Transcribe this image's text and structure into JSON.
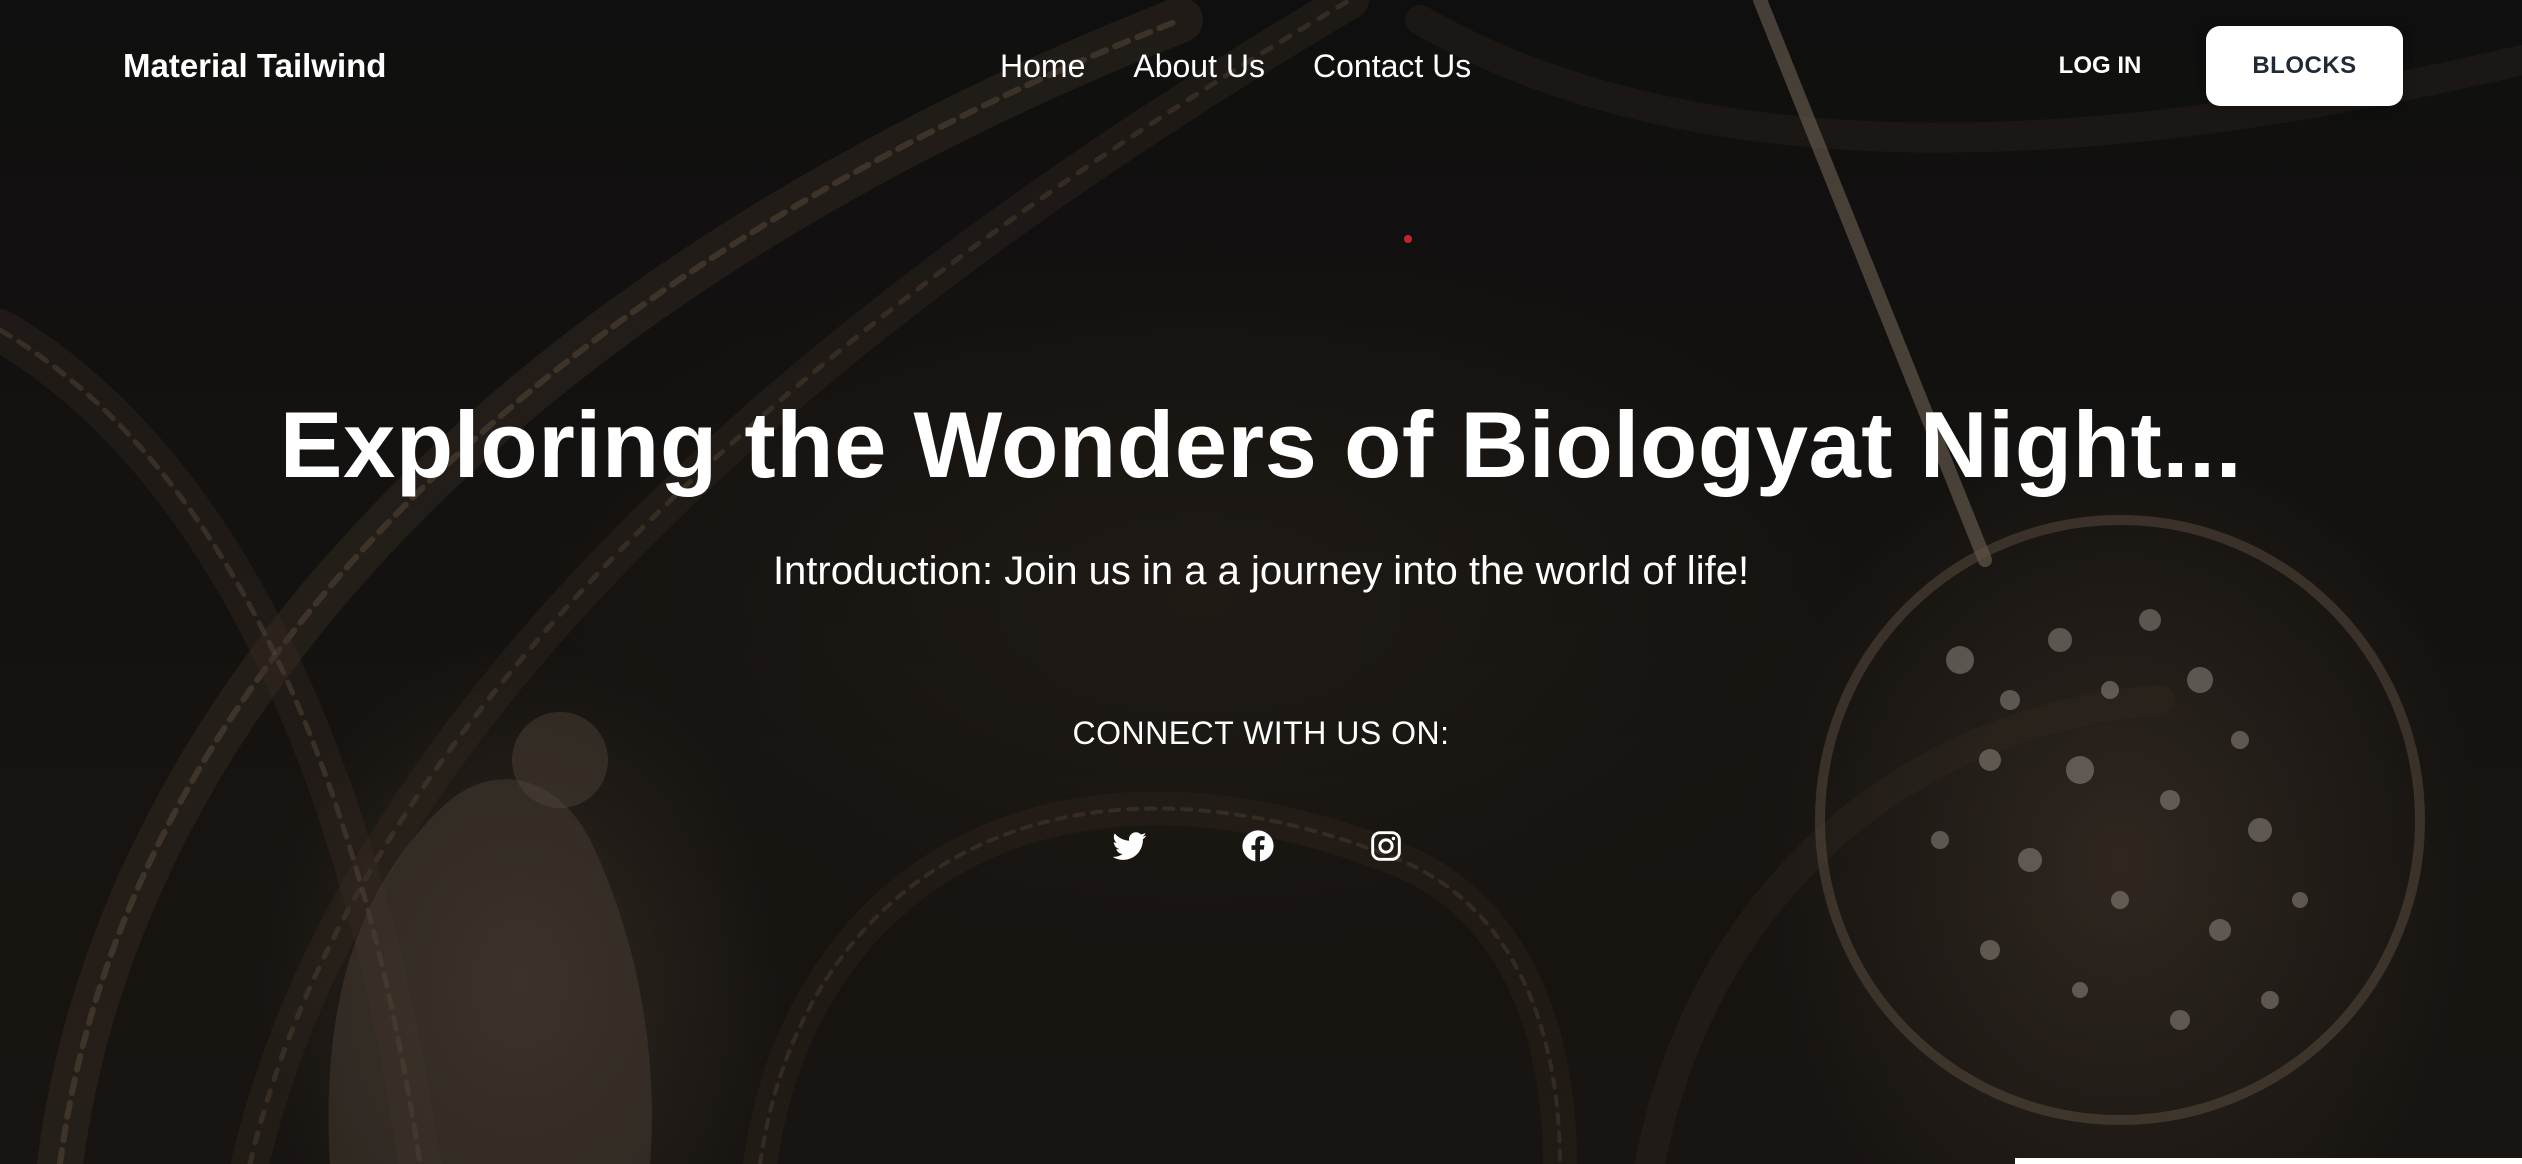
{
  "navbar": {
    "brand": "Material Tailwind",
    "links": [
      {
        "label": "Home"
      },
      {
        "label": "About Us"
      },
      {
        "label": "Contact Us"
      }
    ],
    "login_label": "LOG IN",
    "blocks_label": "BLOCKS"
  },
  "hero": {
    "title": "Exploring the Wonders of Biologyat Night...",
    "subtitle": "Introduction: Join us in a a journey into the world of life!",
    "connect_label": "CONNECT WITH US ON:",
    "socials": [
      {
        "icon": "twitter-icon"
      },
      {
        "icon": "facebook-icon"
      },
      {
        "icon": "instagram-icon"
      }
    ]
  },
  "colors": {
    "background": "#161515",
    "text": "#ffffff",
    "button_bg": "#ffffff",
    "button_text": "#1f2a37",
    "accent_dot": "#c0262d"
  }
}
